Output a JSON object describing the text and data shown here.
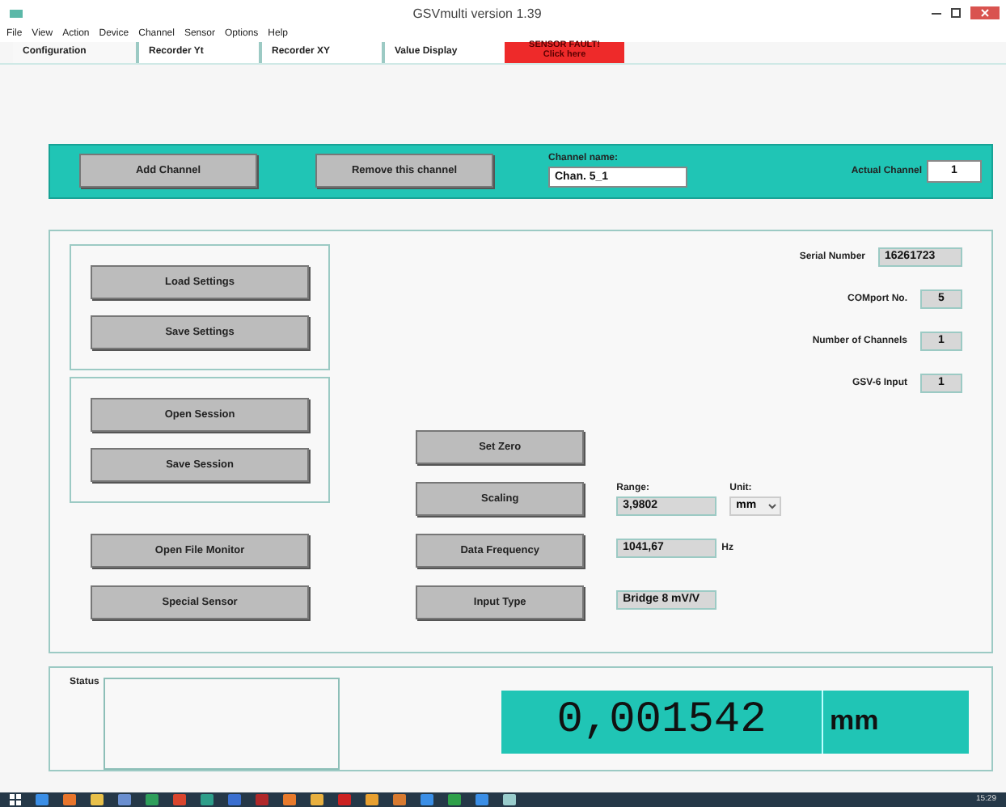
{
  "window": {
    "title": "GSVmulti version 1.39"
  },
  "menu": [
    "File",
    "View",
    "Action",
    "Device",
    "Channel",
    "Sensor",
    "Options",
    "Help"
  ],
  "tabs": [
    {
      "kind": "tab",
      "lines": [
        "Configuration"
      ],
      "selected": true
    },
    {
      "kind": "tab",
      "lines": [
        "Recorder Yt"
      ],
      "selected": false
    },
    {
      "kind": "tab",
      "lines": [
        "Recorder XY"
      ],
      "selected": false
    },
    {
      "kind": "tab",
      "lines": [
        "Value Display"
      ],
      "selected": false
    },
    {
      "kind": "alert",
      "lines": [
        "SENSOR FAULT!",
        "Click here"
      ],
      "selected": false
    }
  ],
  "channel_bar": {
    "buttons": [
      "Add Channel",
      "Remove this channel"
    ],
    "channel_name": {
      "label": "Channel name:",
      "value": "Chan. 5_1"
    },
    "actual_channel": {
      "label": "Actual Channel",
      "value": "1"
    }
  },
  "settings_group": [
    "Load Settings",
    "Save Settings"
  ],
  "session_group": [
    "Open Session",
    "Save Session"
  ],
  "extra_buttons": [
    "Open File Monitor",
    "Special Sensor"
  ],
  "channel_controls": [
    {
      "kind": "button",
      "button": "Set Zero"
    },
    {
      "kind": "range",
      "button": "Scaling",
      "range_label": "Range:",
      "range": "3,9802",
      "unit_label": "Unit:",
      "unit": "mm"
    },
    {
      "kind": "value",
      "button": "Data Frequency",
      "value": "1041,67",
      "suffix": "Hz"
    },
    {
      "kind": "value",
      "button": "Input Type",
      "value": "Bridge 8 mV/V"
    }
  ],
  "device_info": [
    {
      "label": "Serial Number",
      "value": "16261723"
    },
    {
      "label": "COMport No.",
      "value": "5"
    },
    {
      "label": "Number of Channels",
      "value": "1"
    },
    {
      "label": "GSV-6 Input",
      "value": "1"
    }
  ],
  "status": {
    "label": "Status"
  },
  "reading": {
    "value": "0,001542",
    "unit": "mm"
  },
  "taskbar": {
    "clock": "15:29"
  }
}
